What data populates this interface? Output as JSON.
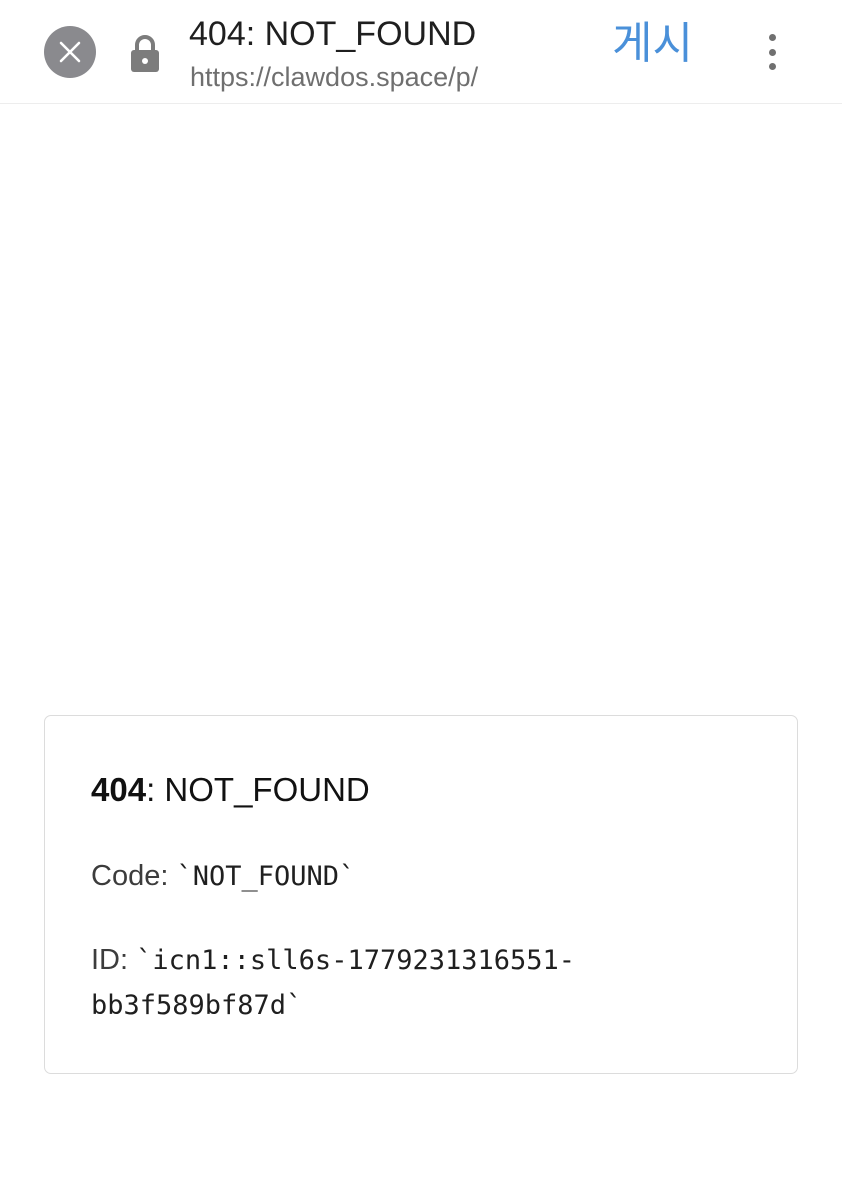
{
  "browser": {
    "page_title": "404: NOT_FOUND",
    "url": "https://clawdos.space/p/",
    "post_button_label": "게시",
    "icons": {
      "close": "close-icon",
      "lock": "lock-icon",
      "more": "more-vert-icon"
    }
  },
  "error_card": {
    "status_code": "404",
    "status_separator": ": ",
    "status_text": "NOT_FOUND",
    "code_label": "Code: ",
    "code_value": "`NOT_FOUND`",
    "id_label": "ID: ",
    "id_value_line1": "`icn1::sll6s-1779231316551-",
    "id_value_line2": "bb3f589bf87d`"
  },
  "colors": {
    "accent": "#4a90d9",
    "close_button": "#8a8a8e",
    "card_border": "#dcdcdc"
  }
}
